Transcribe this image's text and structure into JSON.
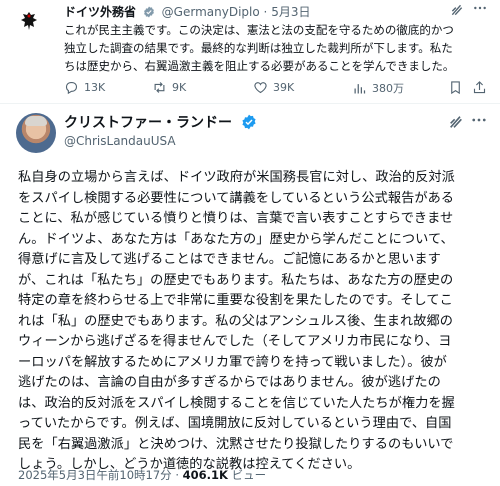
{
  "quoted": {
    "name": "ドイツ外務省",
    "handle": "@GermanyDiplo",
    "date": "5月3日",
    "separator": "·",
    "text": "これが民主主義です。この決定は、憲法と法の支配を守るための徹底的かつ\n独立した調査の結果です。最終的な判断は独立した裁判所が下します。私た\nちは歴史から、右翼過激主義を阻止する必要があることを学んできました。",
    "actions": {
      "replies": "13K",
      "reposts": "9K",
      "likes": "39K",
      "views": "380万"
    }
  },
  "tweet": {
    "name": "クリストファー・ランドー",
    "handle": "@ChrisLandauUSA",
    "text": "私自身の立場から言えば、ドイツ政府が米国務長官に対し、政治的反対派\nをスパイし検閲する必要性について講義をしているという公式報告がある\nことに、私が感じている憤りと憤りは、言葉で言い表すことすらできませ\nん。ドイツよ、あなた方は「あなた方の」歴史から学んだことについて、\n得意げに言及して逃げることはできません。ご記憶にあるかと思います\nが、これは「私たち」の歴史でもあります。私たちは、あなた方の歴史の\n特定の章を終わらせる上で非常に重要な役割を果たしたのです。そしてこ\nれは「私」の歴史でもあります。私の父はアンシュルス後、生まれ故郷の\nウィーンから逃げざるを得ませんでした（そしてアメリカ市民になり、ヨ\nーロッパを解放するためにアメリカ軍で誇りを持って戦いました）。彼が\n逃げたのは、言論の自由が多すぎるからではありません。彼が逃げたの\nは、政治的反対派をスパイし検閲することを信じていた人たちが権力を握\nっていたからです。例えば、国境開放に反対しているという理由で、自国\n民を「右翼過激派」と決めつけ、沈黙させたり投獄したりするのもいいで\nしょう。しかし、どうか道徳的な説教は控えてください。",
    "timestamp": "2025年5月3日午前10時17分",
    "separator": "·",
    "views_count": "406.1K",
    "views_label": "ビュー"
  },
  "icons": [
    "eagle-avatar-icon",
    "verified-gray-icon",
    "grok-icon",
    "more-icon",
    "reply-icon",
    "repost-icon",
    "like-icon",
    "analytics-icon",
    "bookmark-icon",
    "share-icon",
    "verified-blue-icon"
  ],
  "colors": {
    "text": "#0f1419",
    "muted": "#536471",
    "verified_blue": "#1d9bf0",
    "verified_gray": "#829aab"
  }
}
